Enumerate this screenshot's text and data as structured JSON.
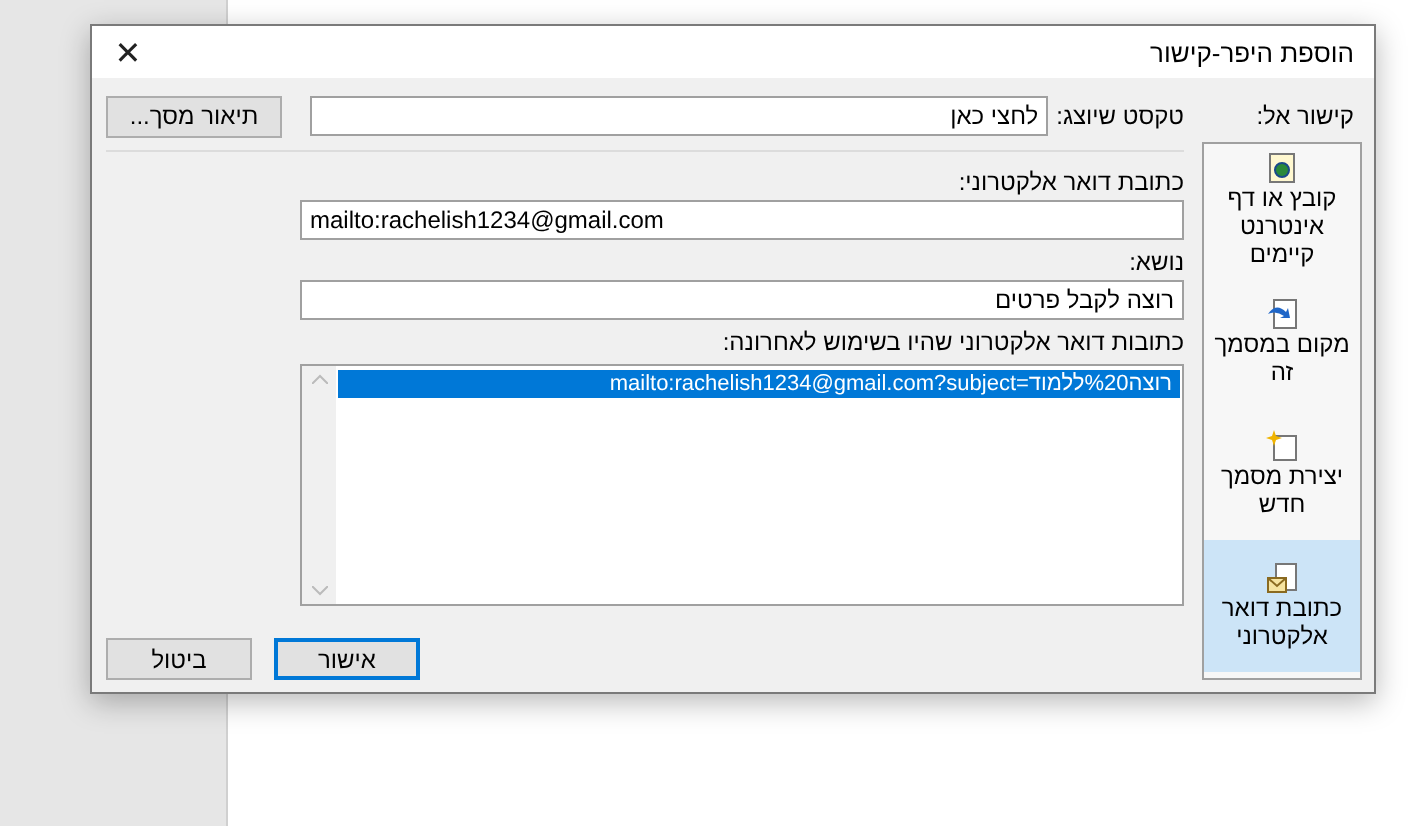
{
  "window": {
    "title": "הוספת היפר-קישור",
    "close": "✕"
  },
  "link_to": {
    "label": "קישור אל:",
    "items": [
      {
        "label": "קובץ או דף אינטרנט קיימים",
        "kind": "web",
        "selected": false
      },
      {
        "label": "מקום במסמך זה",
        "kind": "place",
        "selected": false
      },
      {
        "label": "יצירת מסמך חדש",
        "kind": "new",
        "selected": false
      },
      {
        "label": "כתובת דואר אלקטרוני",
        "kind": "mail",
        "selected": true
      }
    ]
  },
  "display_text": {
    "label": "טקסט שיוצג:",
    "value": "לחצי כאן"
  },
  "screentip_button": "תיאור מסך...",
  "email": {
    "label": "כתובת דואר אלקטרוני:",
    "value": "mailto:rachelish1234@gmail.com"
  },
  "subject": {
    "label": "נושא:",
    "value": "רוצה לקבל פרטים"
  },
  "recent": {
    "label": "כתובות דואר אלקטרוני שהיו בשימוש לאחרונה:",
    "items": [
      {
        "text": "mailto:rachelish1234@gmail.com?subject=רוצה%20ללמוד",
        "selected": true
      }
    ]
  },
  "buttons": [
    {
      "label": "אישור",
      "default": true
    },
    {
      "label": "ביטול",
      "default": false
    }
  ]
}
